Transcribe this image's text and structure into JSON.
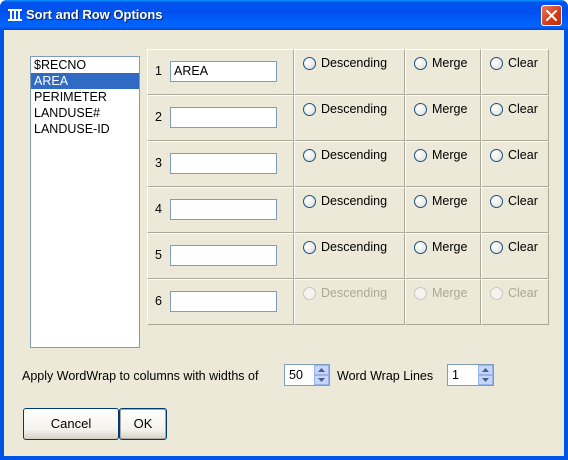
{
  "window": {
    "title": "Sort and Row Options"
  },
  "fields": [
    "$RECNO",
    "AREA",
    "PERIMETER",
    "LANDUSE#",
    "LANDUSE-ID"
  ],
  "selected_field_index": 1,
  "sort_rows": [
    {
      "number": "1",
      "value": "AREA",
      "descending": "Descending",
      "merge": "Merge",
      "clear": "Clear",
      "enabled": true
    },
    {
      "number": "2",
      "value": "",
      "descending": "Descending",
      "merge": "Merge",
      "clear": "Clear",
      "enabled": true
    },
    {
      "number": "3",
      "value": "",
      "descending": "Descending",
      "merge": "Merge",
      "clear": "Clear",
      "enabled": true
    },
    {
      "number": "4",
      "value": "",
      "descending": "Descending",
      "merge": "Merge",
      "clear": "Clear",
      "enabled": true
    },
    {
      "number": "5",
      "value": "",
      "descending": "Descending",
      "merge": "Merge",
      "clear": "Clear",
      "enabled": true
    },
    {
      "number": "6",
      "value": "",
      "descending": "Descending",
      "merge": "Merge",
      "clear": "Clear",
      "enabled": false
    }
  ],
  "wordwrap": {
    "label": "Apply WordWrap to columns with widths of",
    "width_value": "50",
    "lines_label": "Word Wrap Lines",
    "lines_value": "1"
  },
  "buttons": {
    "cancel": "Cancel",
    "ok": "OK"
  },
  "icons": {
    "title": "app-icon",
    "close": "close-icon",
    "spin_up": "spin-up-icon",
    "spin_down": "spin-down-icon"
  },
  "colors": {
    "titlebar": "#0054e3",
    "selection": "#316ac5",
    "dialog_bg": "#ece9d8",
    "close_button": "#d23a16"
  }
}
